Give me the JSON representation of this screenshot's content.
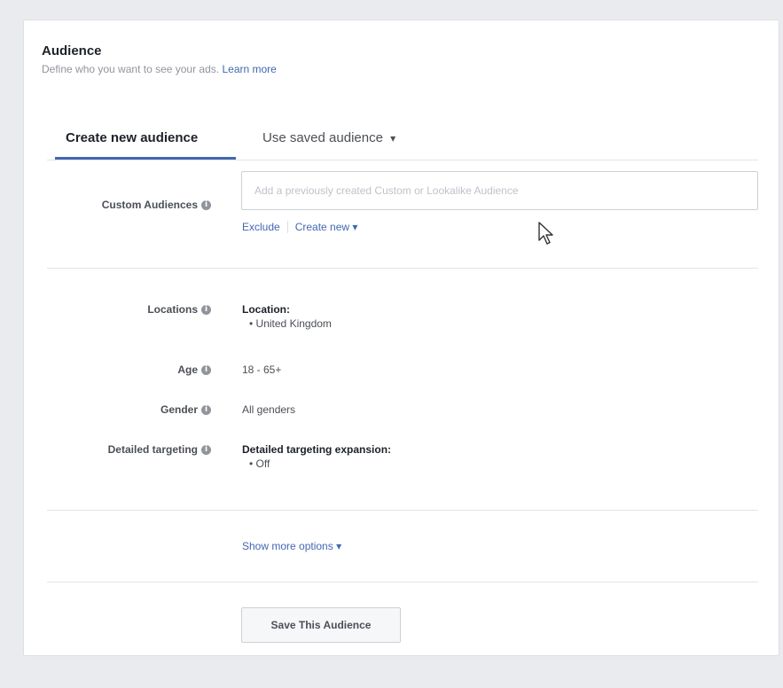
{
  "header": {
    "title": "Audience",
    "subtitle": "Define who you want to see your ads.",
    "learn_more": "Learn more"
  },
  "tabs": {
    "create_new": "Create new audience",
    "use_saved": "Use saved audience",
    "use_saved_caret": "▾"
  },
  "custom_audiences": {
    "label": "Custom Audiences",
    "placeholder": "Add a previously created Custom or Lookalike Audience",
    "exclude": "Exclude",
    "create_new": "Create new",
    "create_new_caret": "▾"
  },
  "locations": {
    "label": "Locations",
    "heading": "Location:",
    "items": [
      "United Kingdom"
    ]
  },
  "age": {
    "label": "Age",
    "value": "18 - 65+"
  },
  "gender": {
    "label": "Gender",
    "value": "All genders"
  },
  "detailed_targeting": {
    "label": "Detailed targeting",
    "heading": "Detailed targeting expansion:",
    "items": [
      "Off"
    ]
  },
  "show_more": {
    "label": "Show more options",
    "caret": "▾"
  },
  "save_button": {
    "label": "Save This Audience"
  },
  "info_glyph": "i",
  "colors": {
    "link": "#4267b2",
    "tab_underline": "#4267b2",
    "background": "#e9ebee"
  },
  "icons": {
    "info": "info-icon",
    "cursor": "mouse-pointer-icon"
  }
}
